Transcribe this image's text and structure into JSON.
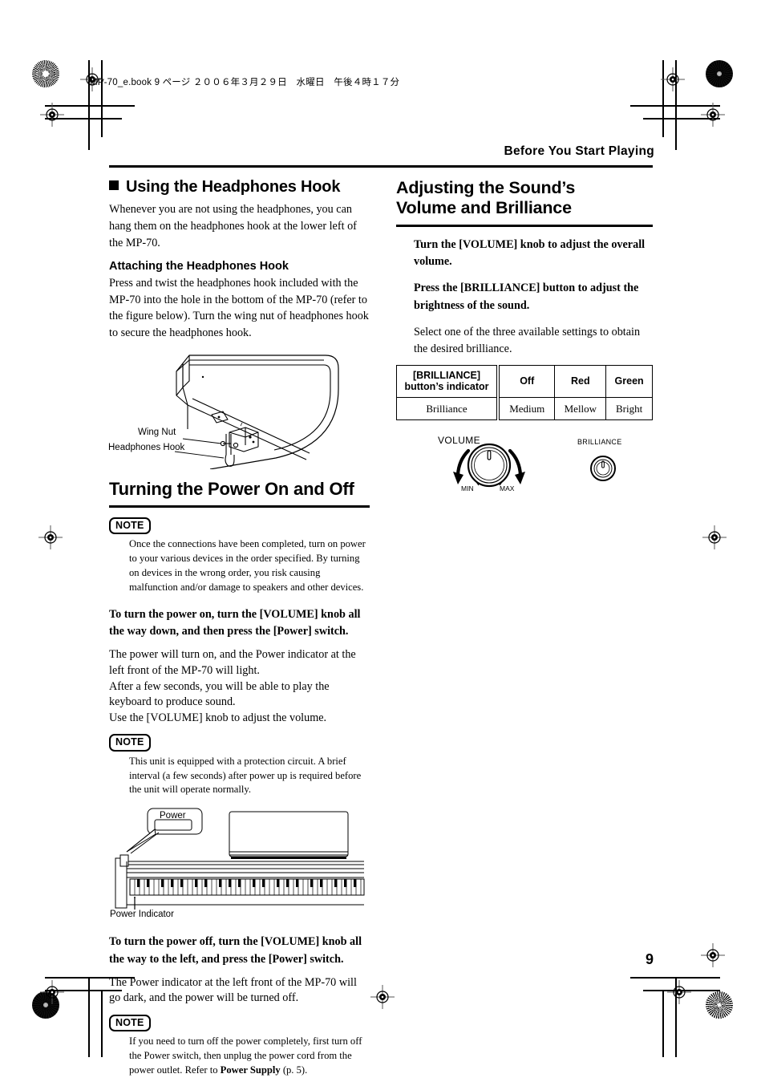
{
  "print_marks": {
    "book_line": "MP-70_e.book  9 ページ  ２００６年３月２９日　水曜日　午後４時１７分"
  },
  "running_head": "Before You Start Playing",
  "page_number": "9",
  "left_column": {
    "section_heading": "Using the Headphones Hook",
    "intro": "Whenever you are not using the headphones, you can hang them on the headphones hook at the lower left of the MP-70.",
    "subheading": "Attaching the Headphones Hook",
    "sub_body": "Press and twist the headphones hook included with the MP-70 into the hole in the bottom of the MP-70 (refer to the figure below). Turn the wing nut of headphones hook to secure the headphones hook.",
    "hook_figure": {
      "label_wing_nut": "Wing Nut",
      "label_headphones_hook": "Headphones Hook"
    },
    "power_heading": "Turning the Power On and Off",
    "note_1": {
      "badge": "NOTE",
      "text": "Once the connections have been completed, turn on power to your various devices in the order specified. By turning on devices in the wrong order, you risk causing malfunction and/or damage to speakers and other devices."
    },
    "power_on_lead": "To turn the power on, turn the [VOLUME] knob all the way down, and then press the [Power] switch.",
    "power_on_body_1": "The power will turn on, and the Power indicator at the left front of the MP-70 will light.",
    "power_on_body_2": "After a few seconds, you will be able to play the keyboard to produce sound.",
    "power_on_body_3": "Use the [VOLUME] knob to adjust the volume.",
    "note_2": {
      "badge": "NOTE",
      "text": "This unit is equipped with a protection circuit. A brief interval (a few seconds) after power up is required before the unit will operate normally."
    },
    "power_figure": {
      "callout_label": "Power",
      "indicator_label": "Power Indicator"
    },
    "power_off_lead": "To turn the power off, turn the [VOLUME] knob all the way to the left, and press the [Power] switch.",
    "power_off_body": "The Power indicator at the left front of the MP-70 will go dark, and the power will be turned off.",
    "note_3": {
      "badge": "NOTE",
      "text_before": "If you need to turn off the power completely, first turn off the Power switch, then unplug the power cord from the power outlet. Refer to ",
      "bold_ref": "Power Supply",
      "text_after": " (p. 5)."
    }
  },
  "right_column": {
    "section_heading_line_1": "Adjusting the Sound’s",
    "section_heading_line_2": "Volume and Brilliance",
    "lead_1": "Turn the [VOLUME] knob to adjust the overall volume.",
    "lead_2": "Press the [BRILLIANCE] button to adjust the brightness of the sound.",
    "body_1": "Select one of the three available settings to obtain the desired brilliance.",
    "table": {
      "header_row": [
        "[BRILLIANCE] button’s indicator",
        "Off",
        "Red",
        "Green"
      ],
      "header_col0_line1": "[BRILLIANCE]",
      "header_col0_line2": "button’s indicator",
      "value_row": [
        "Brilliance",
        "Medium",
        "Mellow",
        "Bright"
      ]
    },
    "knob_figure": {
      "volume_label": "VOLUME",
      "min_label": "MIN",
      "max_label": "MAX",
      "brilliance_label": "BRILLIANCE"
    }
  }
}
